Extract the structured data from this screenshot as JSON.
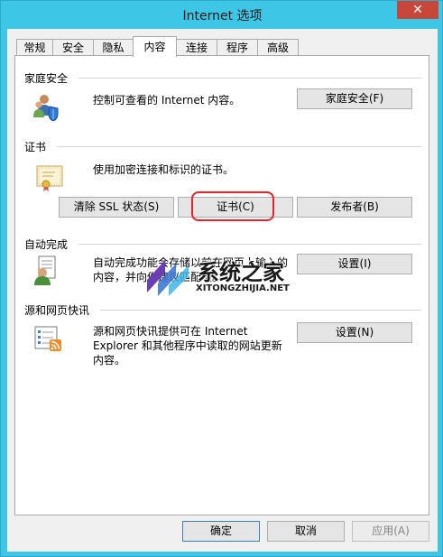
{
  "window": {
    "title": "Internet 选项",
    "close_symbol": "✕"
  },
  "tabs": [
    {
      "label": "常规",
      "active": false
    },
    {
      "label": "安全",
      "active": false
    },
    {
      "label": "隐私",
      "active": false
    },
    {
      "label": "内容",
      "active": true
    },
    {
      "label": "连接",
      "active": false
    },
    {
      "label": "程序",
      "active": false
    },
    {
      "label": "高级",
      "active": false
    }
  ],
  "family_safety": {
    "title": "家庭安全",
    "description": "控制可查看的 Internet 内容。",
    "button": "家庭安全(F)",
    "icon": "family-safety-icon"
  },
  "certificates": {
    "title": "证书",
    "description": "使用加密连接和标识的证书。",
    "buttons": {
      "clear_ssl": "清除 SSL 状态(S)",
      "certificates": "证书(C)",
      "publishers": "发布者(B)"
    },
    "icon": "certificate-icon"
  },
  "autocomplete": {
    "title": "自动完成",
    "description_line1": "自动完成功能会存储以前在网页上输入的",
    "description_line2": "内容，并向你建议匹配项。",
    "button": "设置(I)",
    "icon": "autocomplete-icon"
  },
  "feeds": {
    "title": "源和网页快讯",
    "description_line1": "源和网页快讯提供可在 Internet",
    "description_line2": "Explorer 和其他程序中读取的网站更新",
    "description_line3": "内容。",
    "button": "设置(N)",
    "icon": "rss-feed-icon"
  },
  "footer": {
    "ok": "确定",
    "cancel": "取消",
    "apply": "应用(A)"
  },
  "watermark": {
    "text": "系统之家",
    "sub": "XITONGZHIJIA.NET"
  },
  "colors": {
    "frame": "#3ec6e6",
    "close": "#c7473a",
    "highlight": "#e8222a"
  }
}
